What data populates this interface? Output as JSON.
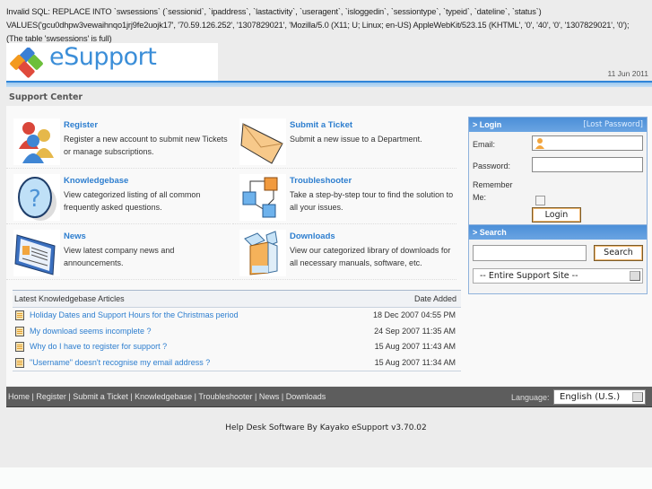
{
  "error": {
    "message": "Invalid SQL: REPLACE INTO `swsessions` (`sessionid`, `ipaddress`, `lastactivity`, `useragent`, `isloggedin`, `sessiontype`, `typeid`, `dateline`, `status`) VALUES('gcu0dhpw3vewaihnqo1jrj9fe2uojk17', '70.59.126.252', '1307829021', 'Mozilla/5.0 (X11; U; Linux; en-US) AppleWebKit/523.15 (KHTML', '0', '40', '0', '1307829021', '0'); (The table 'swsessions' is full)"
  },
  "header": {
    "logo_text": "eSupport",
    "date": "11 Jun 2011",
    "section_title": "Support Center"
  },
  "tiles": [
    {
      "title": "Register",
      "desc": "Register a new account to submit new Tickets or manage subscriptions.",
      "icon": "users-icon"
    },
    {
      "title": "Submit a Ticket",
      "desc": "Submit a new issue to a Department.",
      "icon": "envelope-icon"
    },
    {
      "title": "Knowledgebase",
      "desc": "View categorized listing of all common frequently asked questions.",
      "icon": "question-icon"
    },
    {
      "title": "Troubleshooter",
      "desc": "Take a step-by-step tour to find the solution to all your issues.",
      "icon": "cubes-icon"
    },
    {
      "title": "News",
      "desc": "View latest company news and announcements.",
      "icon": "newspaper-icon"
    },
    {
      "title": "Downloads",
      "desc": "View our categorized library of downloads for all necessary manuals, software, etc.",
      "icon": "box-icon"
    }
  ],
  "kb": {
    "header_label": "Latest Knowledgebase Articles",
    "date_label": "Date Added",
    "articles": [
      {
        "title": "Holiday Dates and Support Hours for the Christmas period",
        "date": "18 Dec 2007 04:55 PM"
      },
      {
        "title": "My download seems incomplete ?",
        "date": "24 Sep 2007 11:35 AM"
      },
      {
        "title": "Why do I have to register for support ?",
        "date": "15 Aug 2007 11:43 AM"
      },
      {
        "title": "\"Username\" doesn't recognise my email address ?",
        "date": "15 Aug 2007 11:34 AM"
      }
    ]
  },
  "login": {
    "title": "> Login",
    "lost_password": "[Lost Password]",
    "email_label": "Email:",
    "email_value": "",
    "password_label": "Password:",
    "password_value": "",
    "remember_label": "Remember Me:",
    "remember_checked": false,
    "button": "Login"
  },
  "search": {
    "title": "> Search",
    "query": "",
    "button": "Search",
    "scope_selected": "-- Entire Support Site --"
  },
  "navbar": {
    "links": [
      "Home",
      "Register",
      "Submit a Ticket",
      "Knowledgebase",
      "Troubleshooter",
      "News",
      "Downloads"
    ],
    "separator": " | ",
    "language_label": "Language:",
    "language_selected": "English (U.S.)"
  },
  "footer": {
    "text": "Help Desk Software By Kayako eSupport v3.70.02"
  },
  "colors": {
    "accent": "#2d7ecf",
    "header_bar": "#2f85d8",
    "navbar": "#5d5d5d"
  }
}
